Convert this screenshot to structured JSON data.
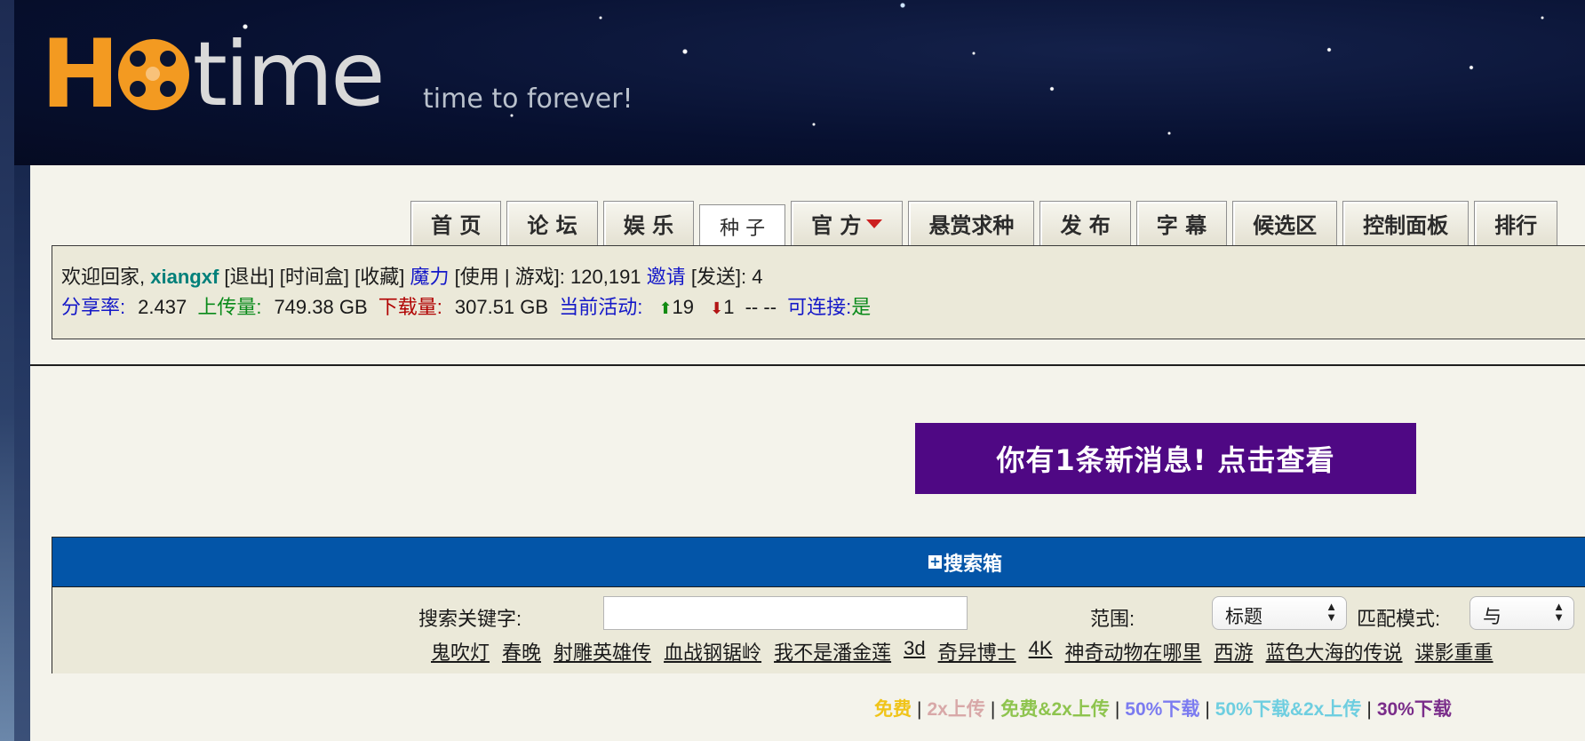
{
  "logo": {
    "letter_h": "H",
    "word": "time",
    "tagline": "time to forever!"
  },
  "nav": {
    "tabs": [
      {
        "label": "首 页",
        "active": false
      },
      {
        "label": "论 坛",
        "active": false
      },
      {
        "label": "娱 乐",
        "active": false
      },
      {
        "label": "种 子",
        "active": true
      },
      {
        "label": "官 方",
        "active": false,
        "dropdown": true
      },
      {
        "label": "悬赏求种",
        "active": false
      },
      {
        "label": "发 布",
        "active": false
      },
      {
        "label": "字 幕",
        "active": false
      },
      {
        "label": "候选区",
        "active": false
      },
      {
        "label": "控制面板",
        "active": false
      },
      {
        "label": "排行",
        "active": false
      }
    ]
  },
  "user": {
    "welcome": "欢迎回家,",
    "username": "xiangxf",
    "logout": "[退出]",
    "timebox": "[时间盒]",
    "favorites": "[收藏]",
    "magic": "魔力",
    "magic_actions": "[使用 | 游戏]: 120,191",
    "invite": "邀请",
    "send": "[发送]: 4",
    "ratio_label": "分享率:",
    "ratio_value": "2.437",
    "upload_label": "上传量:",
    "upload_value": "749.38 GB",
    "download_label": "下载量:",
    "download_value": "307.51 GB",
    "activity_label": "当前活动:",
    "seeding": "19",
    "leeching": "1",
    "activity_extra": "-- --",
    "connectable_label": "可连接:",
    "connectable_value": "是"
  },
  "message_button": "你有1条新消息! 点击查看",
  "search": {
    "title": "搜索箱",
    "keyword_label": "搜索关键字:",
    "keyword_value": "",
    "scope_label": "范围:",
    "scope_value": "标题",
    "match_label": "匹配模式:",
    "match_value": "与",
    "hot_keywords": [
      "鬼吹灯",
      "春晚",
      "射雕英雄传",
      "血战钢锯岭",
      "我不是潘金莲",
      "3d",
      "奇异博士",
      "4K",
      "神奇动物在哪里",
      "西游",
      "蓝色大海的传说",
      "谍影重重"
    ]
  },
  "legend": {
    "free": "免费",
    "x2up": "2x上传",
    "free_x2up": "免费&2x上传",
    "half_down": "50%下载",
    "half_down_x2up": "50%下载&2x上传",
    "thirty_down": "30%下载",
    "separator": "|"
  },
  "colors": {
    "free": "#f0c419",
    "x2up": "#d8a8a8",
    "free_x2up": "#8ec44e",
    "half_down": "#7b7bf0",
    "half_down_x2up": "#6ecee0",
    "thirty_down": "#7a2d8a",
    "message_bg": "#4f0884",
    "search_header": "#0355a8"
  }
}
